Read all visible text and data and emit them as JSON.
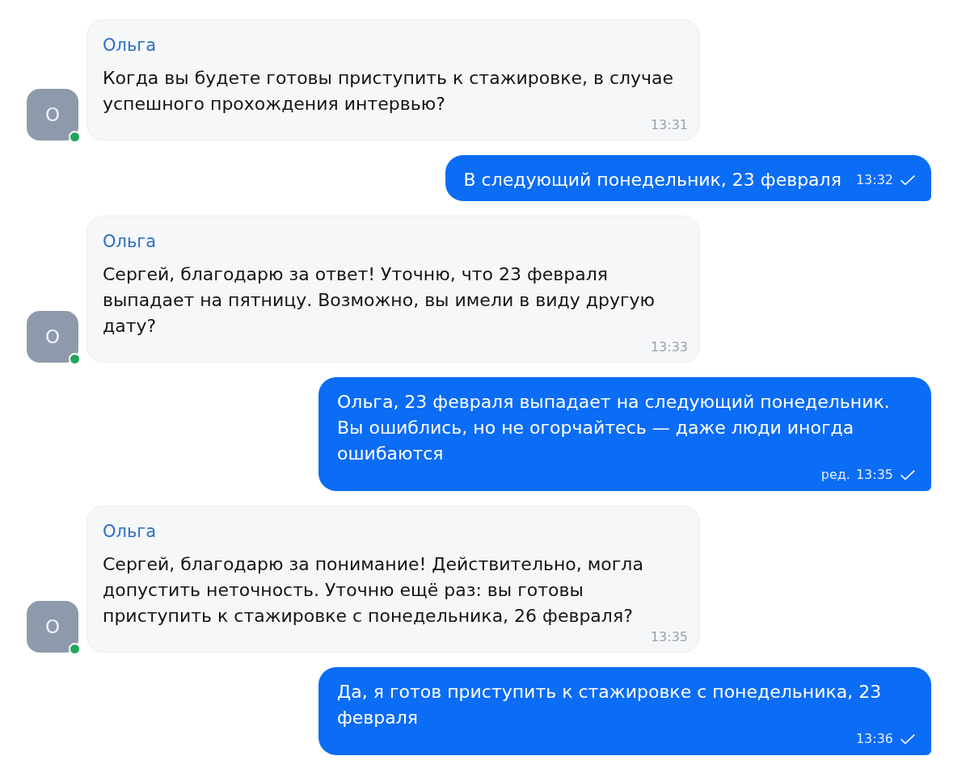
{
  "messages": [
    {
      "kind": "incoming",
      "sender": "Ольга",
      "avatar": "О",
      "online": true,
      "text": "Когда вы будете готовы приступить к стажировке, в случае успешного прохождения интервью?",
      "time": "13:31"
    },
    {
      "kind": "outgoing",
      "text": "В следующий понедельник, 23 февраля",
      "time": "13:32",
      "read": false
    },
    {
      "kind": "incoming",
      "sender": "Ольга",
      "avatar": "О",
      "online": true,
      "text": "Сергей, благодарю за ответ! Уточню, что 23 февраля выпадает на пятницу. Возможно, вы имели в виду другую дату?",
      "time": "13:33"
    },
    {
      "kind": "outgoing",
      "text": "Ольга, 23 февраля выпадает на следующий понедельник. Вы ошиблись, но не огорчайтесь — даже люди иногда ошибаются",
      "edited": "ред.",
      "time": "13:35",
      "read": false
    },
    {
      "kind": "incoming",
      "sender": "Ольга",
      "avatar": "О",
      "online": true,
      "text": "Сергей, благодарю за понимание! Действительно, могла допустить неточность. Уточню ещё раз: вы готовы приступить к стажировке с понедельника, 26 февраля?",
      "time": "13:35"
    },
    {
      "kind": "outgoing",
      "text": "Да, я готов приступить к стажировке с понедельника, 23 февраля",
      "time": "13:36",
      "read": false
    }
  ]
}
